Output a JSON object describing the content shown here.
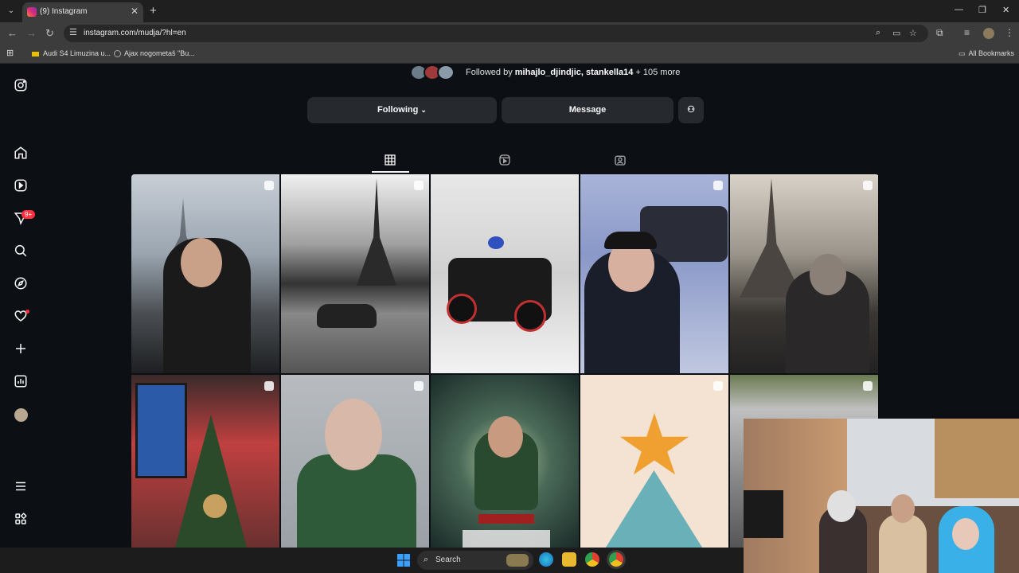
{
  "browser": {
    "tab_title": "(9) Instagram",
    "url": "instagram.com/mudja/?hl=en",
    "bookmarks": [
      "Audi S4 Limuzina u...",
      "Ajax nogometaš \"Bu..."
    ],
    "all_bookmarks_label": "All Bookmarks"
  },
  "profile": {
    "followed_by_prefix": "Followed by",
    "followed_by_names": "mihajlo_djindjic, stankella14",
    "followed_by_more": "+ 105 more",
    "following_label": "Following",
    "message_label": "Message"
  },
  "sidebar": {
    "notifications_badge": "9+"
  },
  "tabs": [
    "posts-grid",
    "reels",
    "tagged"
  ],
  "posts": [
    {
      "type": "reel",
      "scene": "man-eiffel-tower-smiling"
    },
    {
      "type": "reel",
      "scene": "eiffel-tower-car"
    },
    {
      "type": "reel",
      "scene": "atv-snow"
    },
    {
      "type": "carousel",
      "scene": "man-snow-truck"
    },
    {
      "type": "reel",
      "scene": "man-eiffel-bw"
    },
    {
      "type": "reel",
      "scene": "christmas-tree-window"
    },
    {
      "type": "reel",
      "scene": "man-green-car"
    },
    {
      "type": "image",
      "scene": "poster-predator"
    },
    {
      "type": "reel",
      "scene": "star-tree-drawing"
    },
    {
      "type": "carousel",
      "scene": "building-roof"
    }
  ],
  "taskbar": {
    "search_label": "Search"
  },
  "colors": {
    "page_bg": "#0c1014",
    "button_bg": "#262a2f",
    "badge": "#ff3040"
  }
}
